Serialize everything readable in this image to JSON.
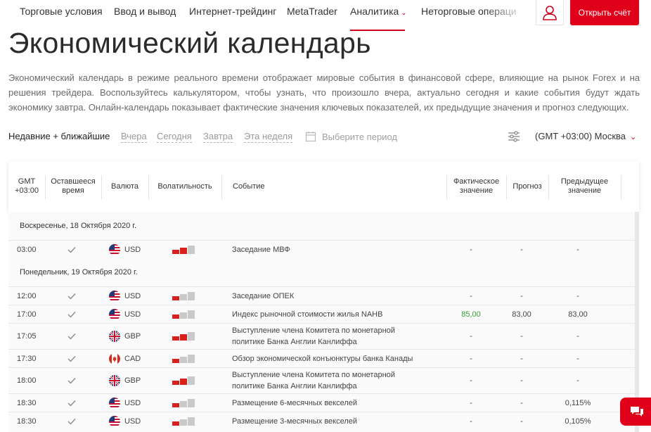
{
  "nav": {
    "items": [
      "Торговые условия",
      "Ввод и вывод",
      "Интернет-трейдинг",
      "MetaTrader",
      "Аналитика",
      "Неторговые операци"
    ],
    "active_index": 4,
    "open_account": "Открыть счёт",
    "accent": "#e1001a"
  },
  "page": {
    "title": "Экономический календарь",
    "description": "Экономический календарь в режиме реального времени отображает мировые события в финансовой сфере, влияющие на рынок Forex и на решения трейдера. Воспользуйтесь калькулятором, чтобы узнать, что произошло вчера, актуально сегодня и какие события будут ждать экономику завтра. Онлайн-календарь показывает фактические значения ключевых показателей, их предыдущие значения и прогноз следующих."
  },
  "filters": {
    "recent": "Недавние + ближайшие",
    "yesterday": "Вчера",
    "today": "Сегодня",
    "tomorrow": "Завтра",
    "week": "Эта неделя",
    "period_placeholder": "Выберите период",
    "timezone": "(GMT +03:00) Москва"
  },
  "table": {
    "headers": {
      "gmt": "GMT\n+03:00",
      "remaining": "Оставшееся\nвремя",
      "currency": "Валюта",
      "volatility": "Волатильность",
      "event": "Событие",
      "actual": "Фактическое\nзначение",
      "forecast": "Прогноз",
      "previous": "Предыдущее\nзначение"
    },
    "days": [
      {
        "date": "Воскресенье, 18 Октября 2020 г.",
        "rows": [
          {
            "time": "03:00",
            "currency": "USD",
            "flag": "us",
            "volatility": 2,
            "event": "Заседание МВФ",
            "actual": "-",
            "forecast": "-",
            "previous": "-"
          }
        ]
      },
      {
        "date": "Понедельник, 19 Октября 2020 г.",
        "rows": [
          {
            "time": "12:00",
            "currency": "USD",
            "flag": "us",
            "volatility": 1,
            "event": "Заседание ОПЕК",
            "actual": "-",
            "forecast": "-",
            "previous": "-"
          },
          {
            "time": "17:00",
            "currency": "USD",
            "flag": "us",
            "volatility": 1,
            "event": "Индекс рыночной стоимости жилья NAHB",
            "actual": "85,00",
            "actual_better": true,
            "forecast": "83,00",
            "previous": "83,00"
          },
          {
            "time": "17:05",
            "currency": "GBP",
            "flag": "gb",
            "volatility": 2,
            "event": "Выступление члена Комитета по монетарной\nполитике Банка Англии Канлиффа",
            "actual": "-",
            "forecast": "-",
            "previous": "-"
          },
          {
            "time": "17:30",
            "currency": "CAD",
            "flag": "ca",
            "volatility": 1,
            "event": "Обзор экономической конъюнктуры банка Канады",
            "actual": "-",
            "forecast": "-",
            "previous": "-"
          },
          {
            "time": "18:00",
            "currency": "GBP",
            "flag": "gb",
            "volatility": 2,
            "event": "Выступление члена Комитета по монетарной\nполитике Банка Англии Канлиффа",
            "actual": "-",
            "forecast": "-",
            "previous": "-"
          },
          {
            "time": "18:30",
            "currency": "USD",
            "flag": "us",
            "volatility": 1,
            "event": "Размещение 6-месячных векселей",
            "actual": "-",
            "forecast": "-",
            "previous": "0,115%"
          },
          {
            "time": "18:30",
            "currency": "USD",
            "flag": "us",
            "volatility": 1,
            "event": "Размещение 3-месячных векселей",
            "actual": "-",
            "forecast": "-",
            "previous": "0,105%"
          }
        ]
      }
    ]
  }
}
